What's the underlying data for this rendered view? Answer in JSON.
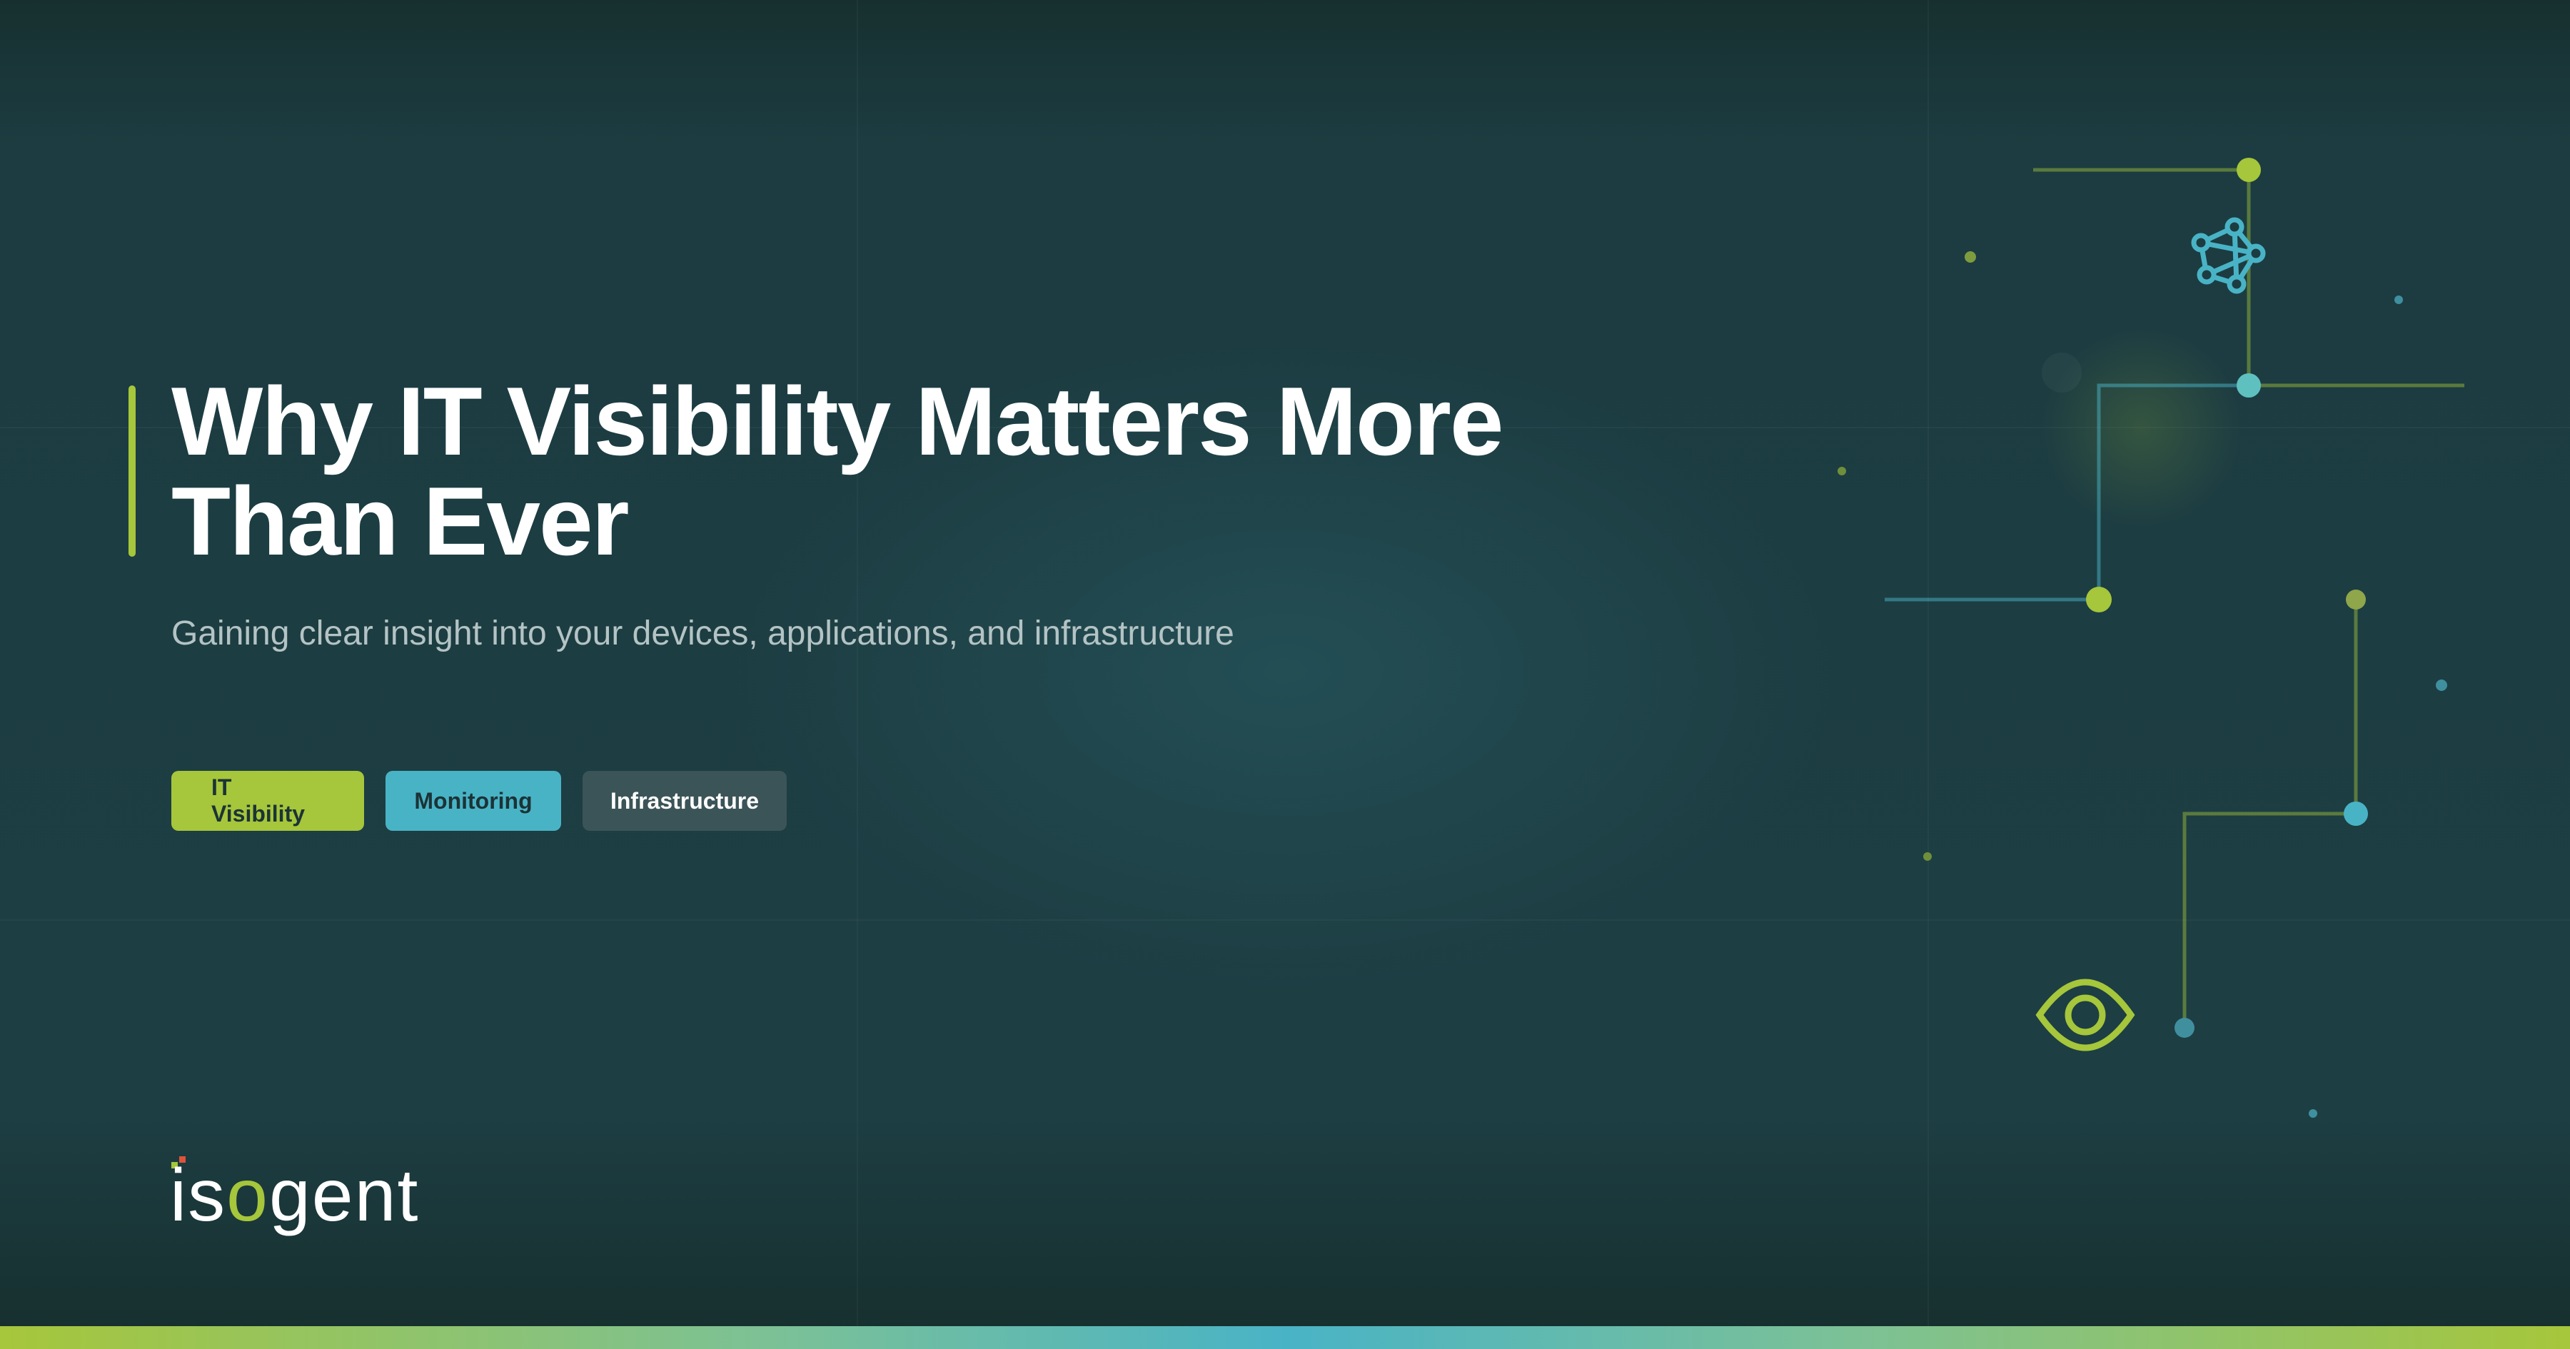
{
  "hero": {
    "title": "Why IT Visibility Matters More Than Ever",
    "subtitle": "Gaining clear insight into your devices, applications, and infrastructure"
  },
  "tags": [
    {
      "label": "IT Visibility",
      "color": "#a6c63b"
    },
    {
      "label": "Monitoring",
      "color": "#49b3c6"
    },
    {
      "label": "Infrastructure",
      "color": "#3b5458"
    }
  ],
  "brand": {
    "logo_text": "isogent",
    "logo_parts": [
      "is",
      "o",
      "gent"
    ],
    "accent_green": "#a6c63b",
    "accent_teal": "#49b3c6",
    "background": "#1c3c41"
  },
  "icons": {
    "network": "network-icon",
    "eye": "eye-icon"
  }
}
